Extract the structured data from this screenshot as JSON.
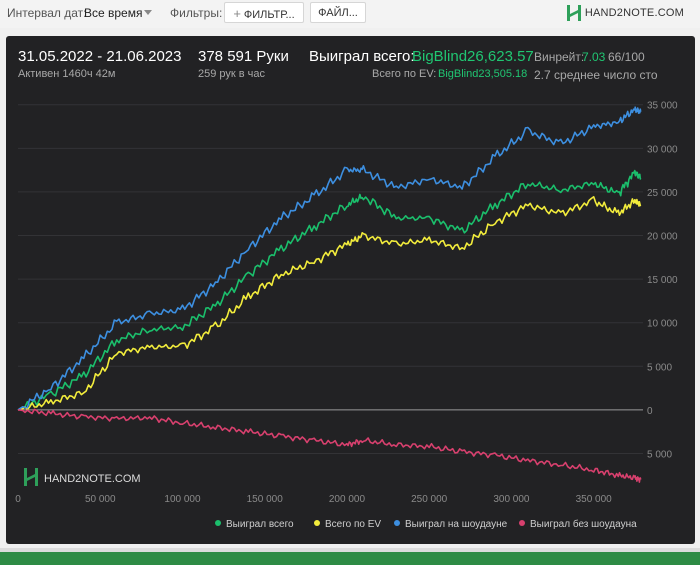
{
  "toolbar": {
    "date_interval_label": "Интервал дат:",
    "date_interval_value": "Все время",
    "filters_label": "Фильтры:",
    "filter_button": "ФИЛЬТР...",
    "filter_plus": "+",
    "file_button": "ФАЙЛ...",
    "brand": "HAND2NOTE.COM"
  },
  "summary": {
    "date_range": "31.05.2022 - 21.06.2023",
    "active_time": "Активен 1460ч 42м",
    "hands": "378 591 Руки",
    "hands_per_hour": "259 рук в час",
    "won_total_label": "Выиграл всего:",
    "won_total_value": "BigBlind26,623.57",
    "ev_total_label": "Всего по EV:",
    "ev_total_value": "BigBlind23,505.18",
    "winrate_label": "Винрейт:",
    "winrate_value": "7.03",
    "winrate_suffix": "66/100",
    "avg_pot": "2.7 среднее число сто"
  },
  "chart_watermark": "HAND2NOTE.COM",
  "colors": {
    "green": "#1bbf6c",
    "yellow": "#f2ec3c",
    "blue": "#3d8fe0",
    "pink": "#d8406e",
    "panel": "#222224"
  },
  "chart_data": {
    "type": "line",
    "x_ticks": [
      0,
      50000,
      100000,
      150000,
      200000,
      250000,
      300000,
      350000
    ],
    "x_tick_labels": [
      "0",
      "50 000",
      "100 000",
      "150 000",
      "200 000",
      "250 000",
      "300 000",
      "350 000"
    ],
    "y_ticks": [
      35000,
      30000,
      25000,
      20000,
      15000,
      10000,
      5000,
      0,
      -5000
    ],
    "y_tick_labels": [
      "35 000",
      "30 000",
      "25 000",
      "20 000",
      "15 000",
      "10 000",
      "5 000",
      "0",
      "5 000"
    ],
    "xlim": [
      0,
      380000
    ],
    "ylim": [
      -8500,
      36000
    ],
    "legend_position": "bottom-right",
    "x": [
      0,
      20000,
      40000,
      60000,
      80000,
      100000,
      120000,
      140000,
      160000,
      180000,
      200000,
      210000,
      230000,
      250000,
      270000,
      290000,
      310000,
      330000,
      350000,
      365000,
      375000,
      378591
    ],
    "series": [
      {
        "name": "Выиграл всего",
        "color": "#1bbf6c",
        "values": [
          0,
          1800,
          4000,
          8000,
          9200,
          9500,
          12000,
          15500,
          18500,
          21000,
          23500,
          24500,
          22000,
          22000,
          20500,
          23500,
          26000,
          25200,
          26000,
          24800,
          27200,
          26600
        ]
      },
      {
        "name": "Всего по EV",
        "color": "#f2ec3c",
        "values": [
          0,
          900,
          2000,
          6500,
          7200,
          7300,
          9500,
          13000,
          15500,
          17000,
          19000,
          20000,
          19000,
          19500,
          18500,
          21500,
          23500,
          22500,
          24000,
          22500,
          24000,
          23500
        ]
      },
      {
        "name": "Выиграл на шоудауне",
        "color": "#3d8fe0",
        "values": [
          0,
          2500,
          6000,
          10000,
          11000,
          11500,
          14500,
          18500,
          22000,
          24500,
          27500,
          27500,
          25500,
          26500,
          25500,
          29000,
          32000,
          30500,
          32500,
          33000,
          34500,
          34200
        ]
      },
      {
        "name": "Выиграл без шоудауна",
        "color": "#d8406e",
        "values": [
          0,
          -400,
          -800,
          -1000,
          -900,
          -1500,
          -2000,
          -2500,
          -3000,
          -3500,
          -4000,
          -3500,
          -4000,
          -4200,
          -4800,
          -5200,
          -5800,
          -6300,
          -6900,
          -7500,
          -7800,
          -8000
        ]
      }
    ]
  }
}
